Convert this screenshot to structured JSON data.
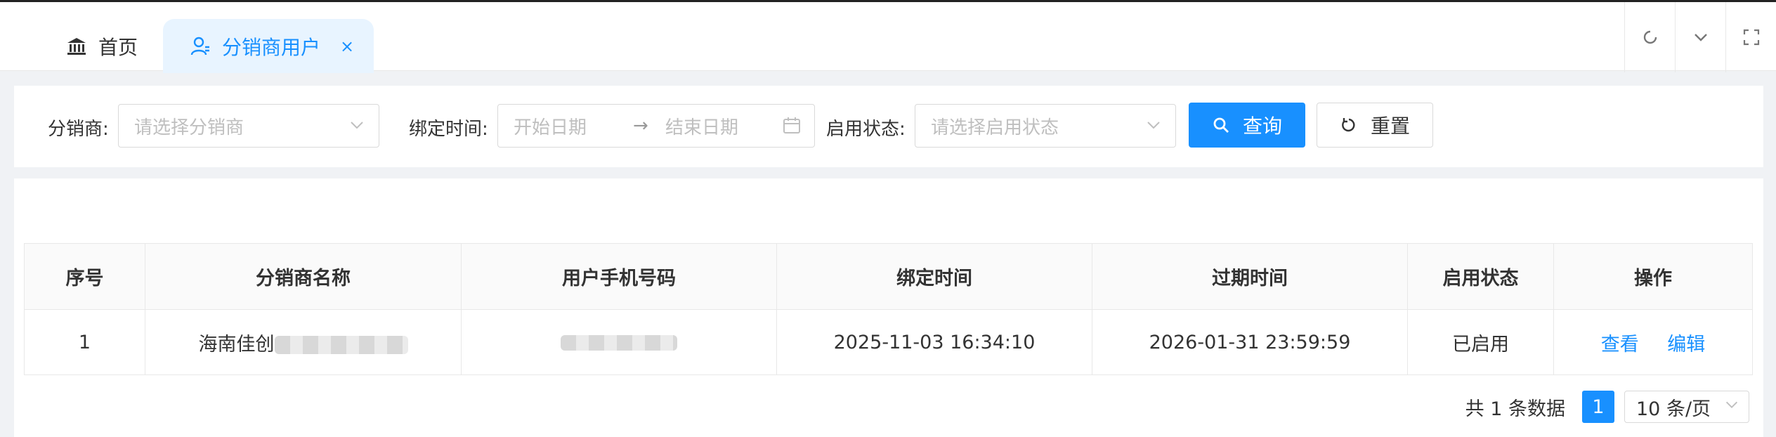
{
  "tabs": {
    "home_label": "首页",
    "active_label": "分销商用户",
    "close_glyph": "×"
  },
  "filters": {
    "distributor_label": "分销商:",
    "distributor_placeholder": "请选择分销商",
    "bind_time_label": "绑定时间:",
    "start_placeholder": "开始日期",
    "range_separator": "→",
    "end_placeholder": "结束日期",
    "status_label": "启用状态:",
    "status_placeholder": "请选择启用状态",
    "query_button": "查询",
    "reset_button": "重置"
  },
  "table": {
    "headers": [
      "序号",
      "分销商名称",
      "用户手机号码",
      "绑定时间",
      "过期时间",
      "启用状态",
      "操作"
    ],
    "rows": [
      {
        "index": "1",
        "name_visible": "海南佳创",
        "bind_time": "2025-11-03 16:34:10",
        "expire_time": "2026-01-31 23:59:59",
        "status": "已启用",
        "action_view": "查看",
        "action_edit": "编辑"
      }
    ]
  },
  "pagination": {
    "total_text": "共 1 条数据",
    "current_page": "1",
    "page_size": "10 条/页"
  }
}
